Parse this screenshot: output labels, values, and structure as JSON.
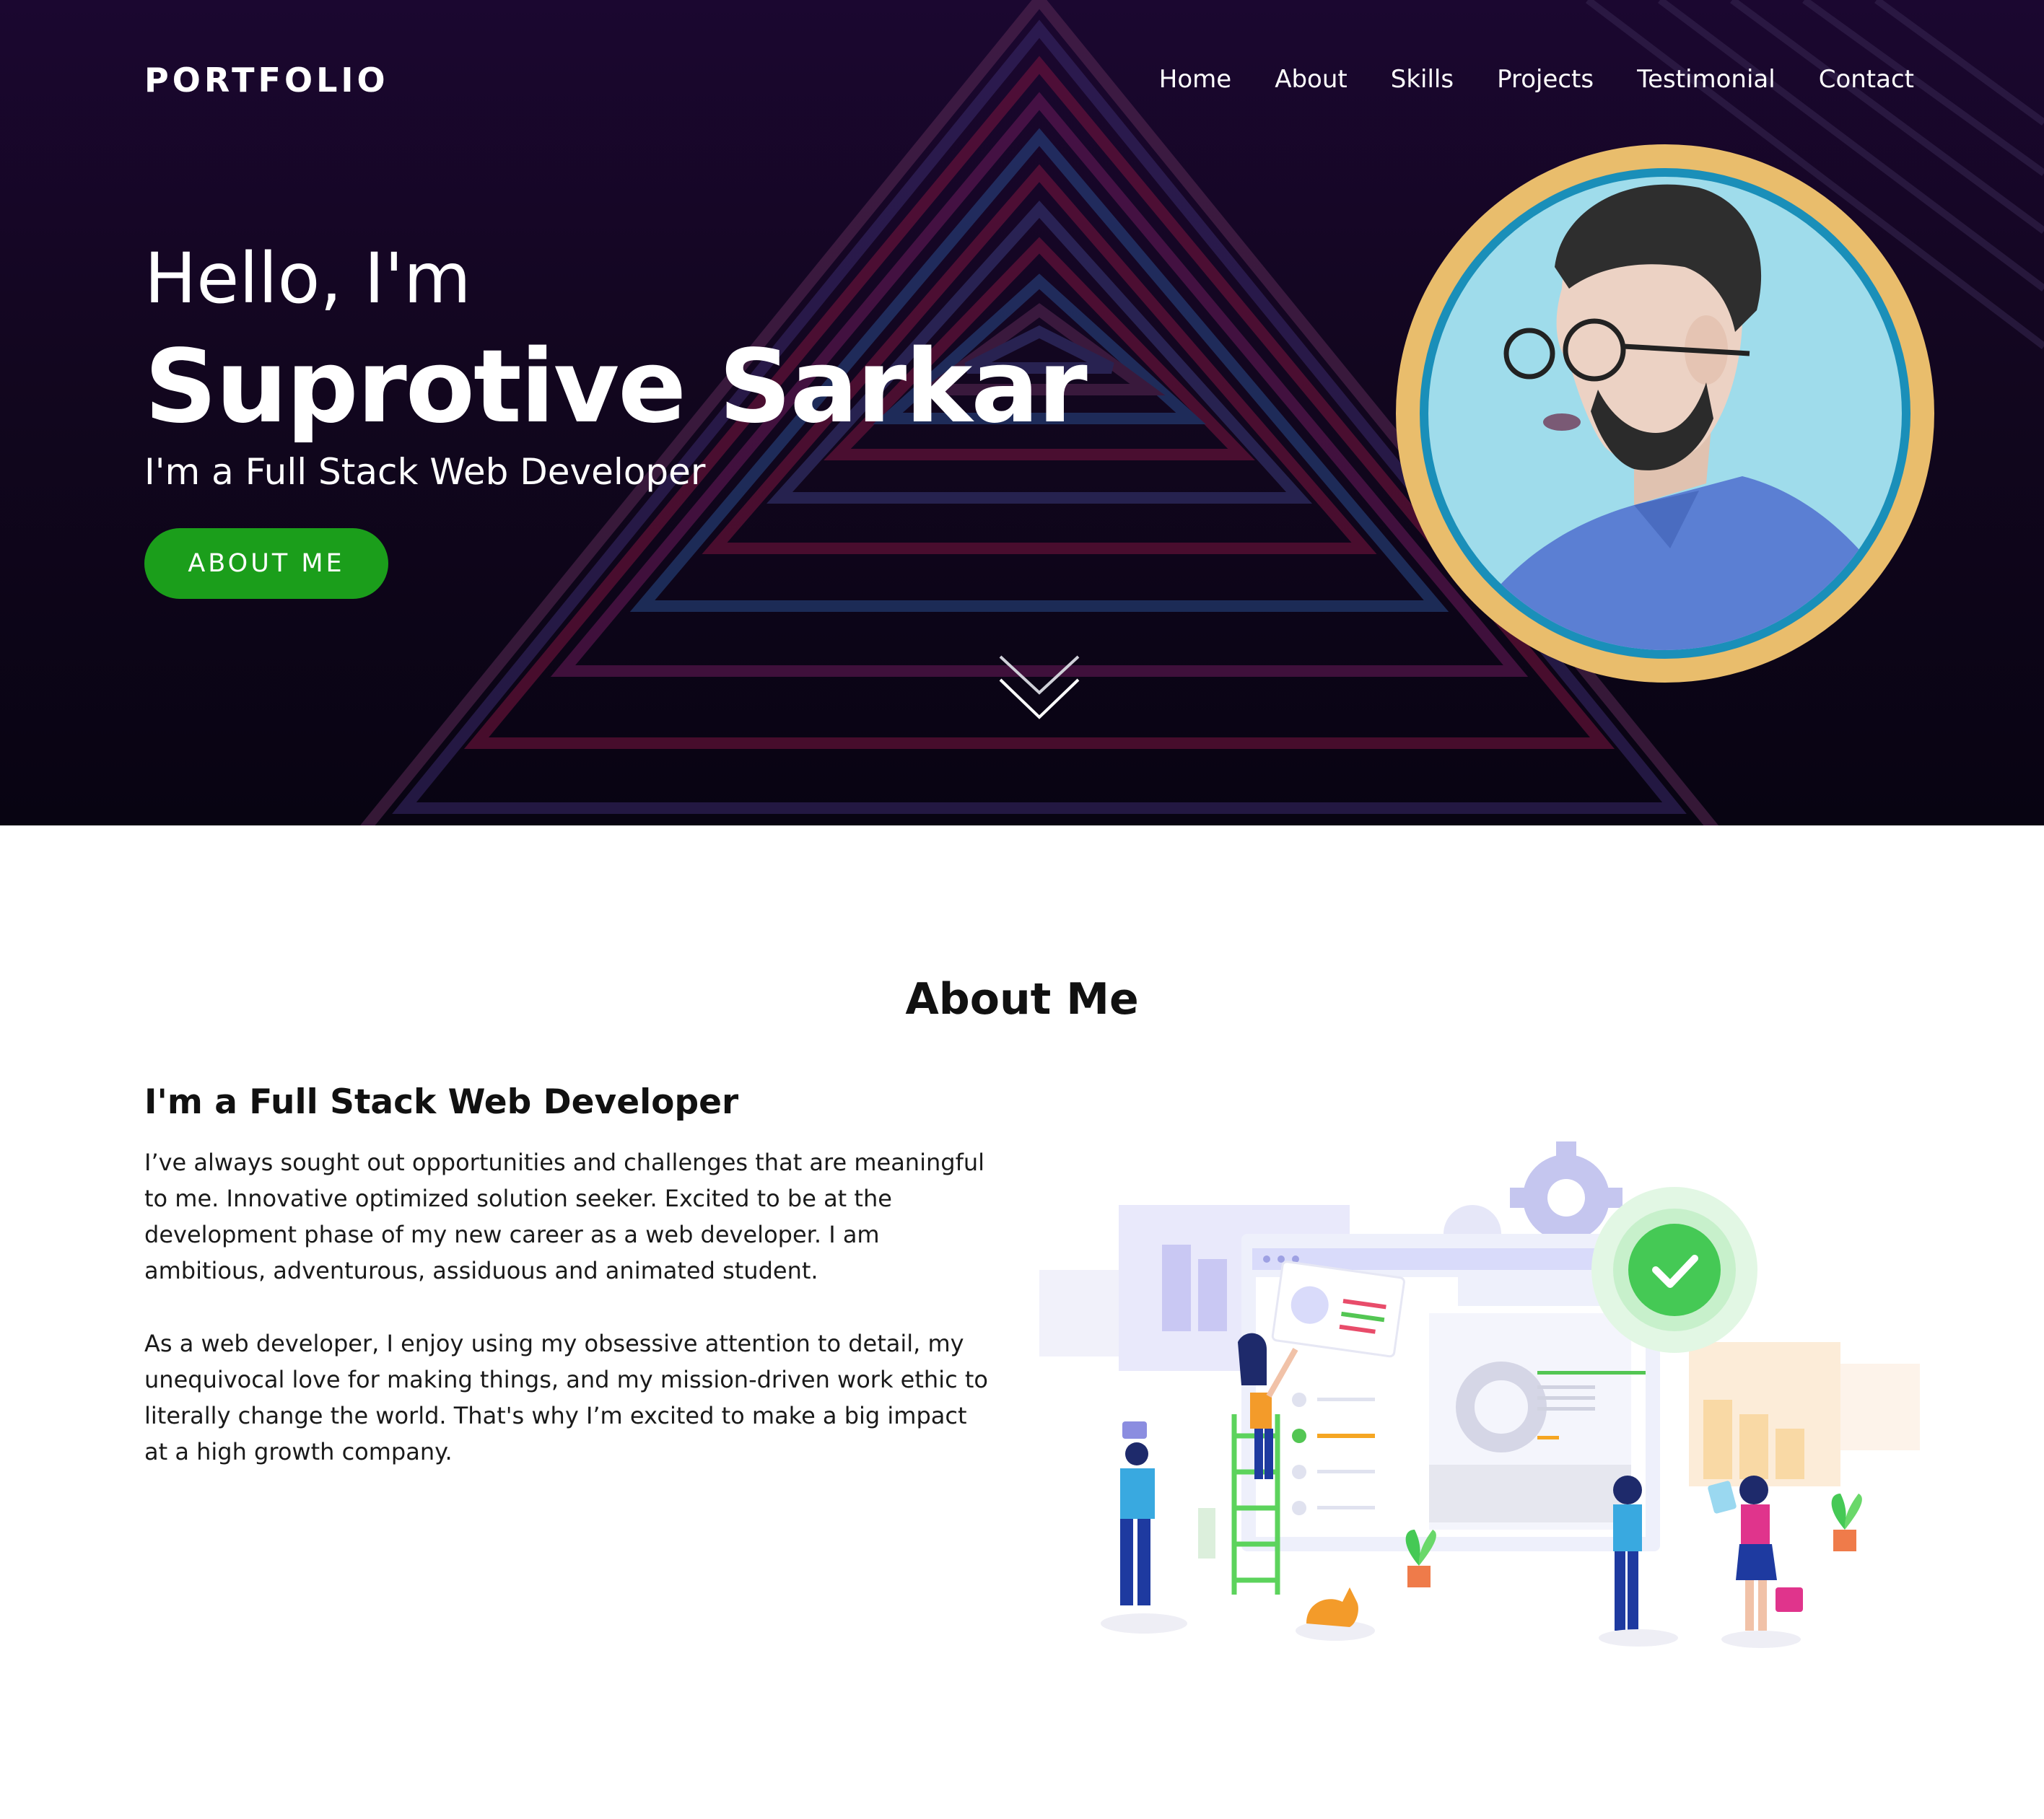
{
  "header": {
    "brand": "PORTFOLIO",
    "nav": [
      "Home",
      "About",
      "Skills",
      "Projects",
      "Testimonial",
      "Contact"
    ]
  },
  "hero": {
    "greeting": "Hello, I'm",
    "name": "Suprotive Sarkar",
    "role": "I'm a Full Stack Web Developer",
    "cta_label": "ABOUT ME"
  },
  "about": {
    "title": "About Me",
    "subtitle": "I'm a Full Stack Web Developer",
    "paragraph1": "I’ve always sought out opportunities and challenges that are meaningful to me. Innovative optimized solution seeker. Excited to be at the development phase of my new career as a web developer. I am ambitious, adventurous, assiduous and animated student.",
    "paragraph2": "As a web developer, I enjoy using my obsessive attention to detail, my unequivocal love for making things, and my mission-driven work ethic to literally change the world. That's why I’m excited to make a big impact at a high growth company."
  },
  "colors": {
    "hero_bg": "#1b0730",
    "accent_green": "#1b9e1b",
    "avatar_ring_gold": "#e9bd6c",
    "avatar_ring_blue": "#1a8fb9",
    "avatar_bg": "#9fdceb"
  },
  "icons": {
    "scroll": "chevron-down-double-icon",
    "check": "check-circle-icon",
    "gear": "gear-icon"
  }
}
